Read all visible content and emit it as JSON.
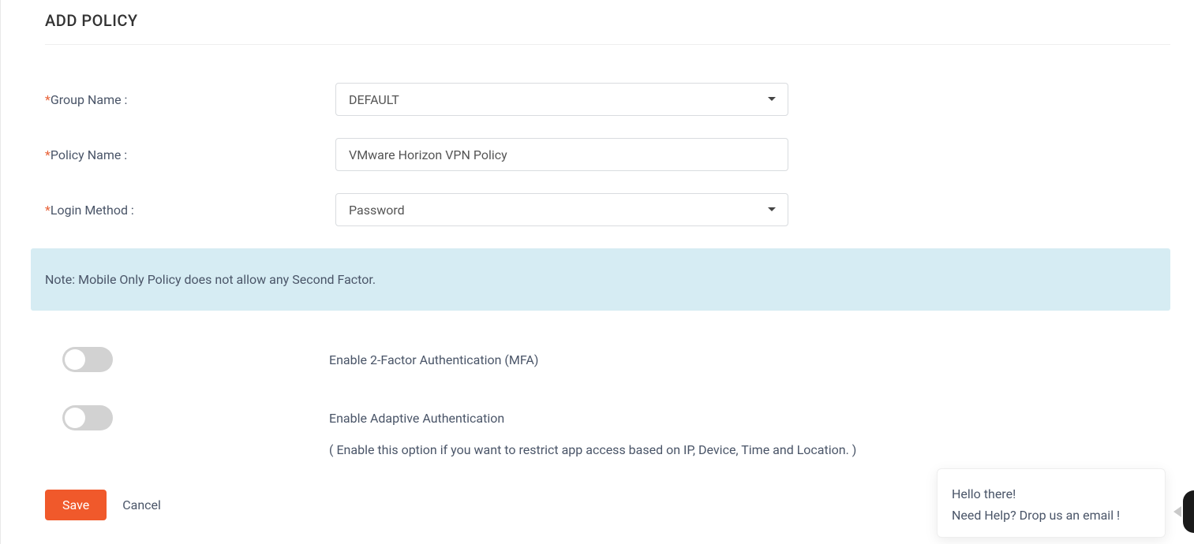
{
  "page": {
    "title": "ADD POLICY"
  },
  "form": {
    "group_name": {
      "label": "Group Name :",
      "value": "DEFAULT"
    },
    "policy_name": {
      "label": "Policy Name :",
      "value": "VMware Horizon VPN Policy"
    },
    "login_method": {
      "label": "Login Method :",
      "value": "Password"
    }
  },
  "note": "Note: Mobile Only Policy does not allow any Second Factor.",
  "toggles": {
    "mfa": {
      "label": "Enable 2-Factor Authentication (MFA)"
    },
    "adaptive": {
      "label": "Enable Adaptive Authentication",
      "hint": "( Enable this option if you want to restrict app access based on IP, Device, Time and Location. )"
    }
  },
  "actions": {
    "save": "Save",
    "cancel": "Cancel"
  },
  "help": {
    "line1": "Hello there!",
    "line2": "Need Help? Drop us an email !"
  }
}
